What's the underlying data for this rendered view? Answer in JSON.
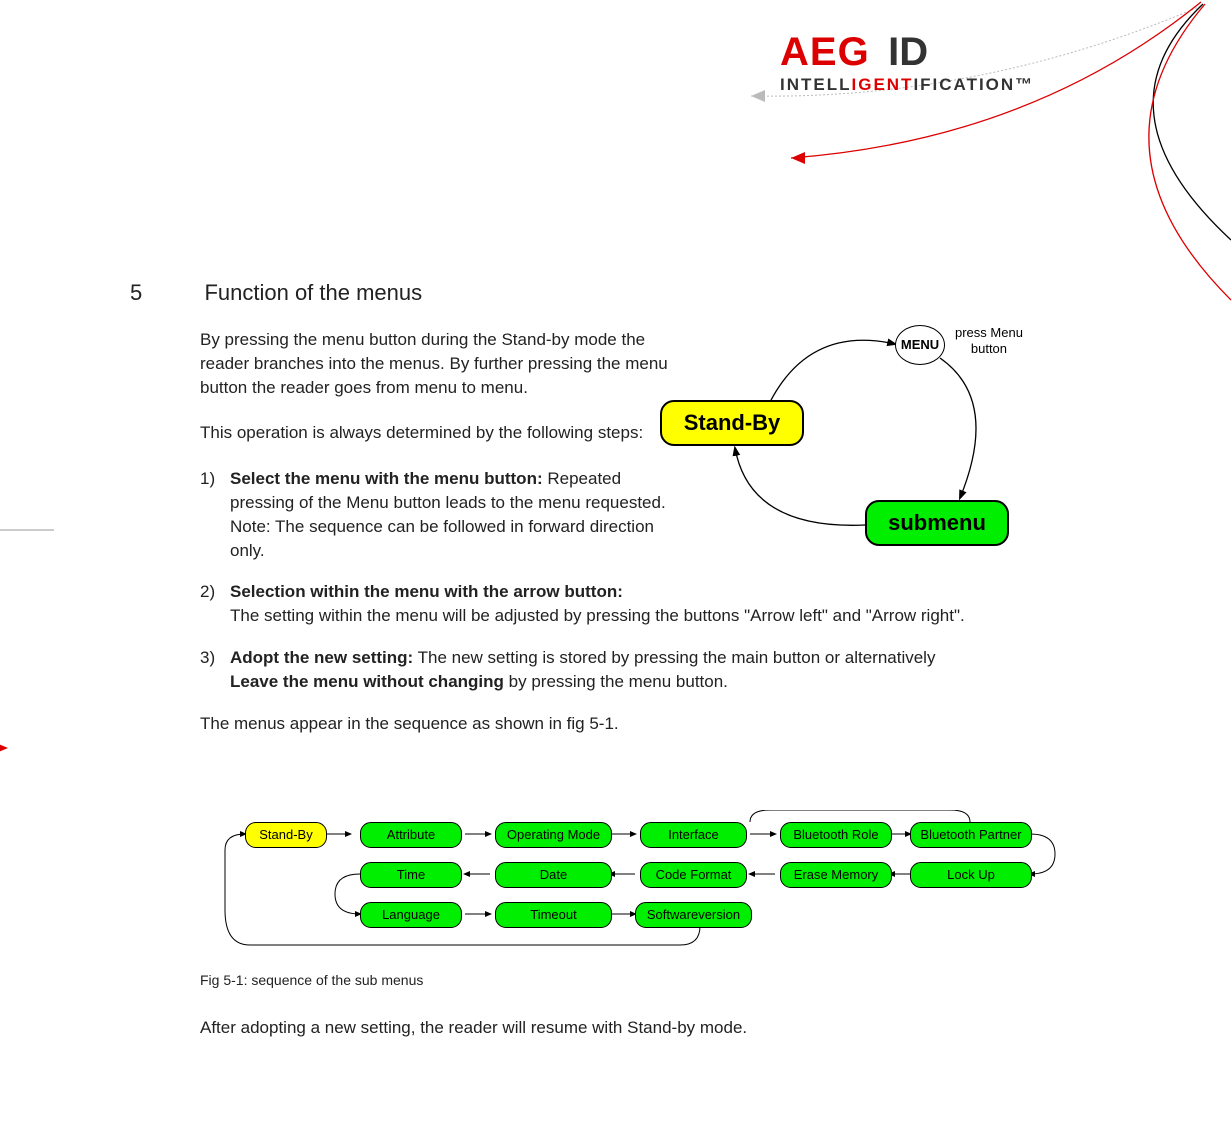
{
  "logo": {
    "brand1": "AEG",
    "brand2": "ID",
    "tagline_prefix": "INTELL",
    "tagline_mid": "IGENT",
    "tagline_suffix": "IFICATION™"
  },
  "section": {
    "number": "5",
    "title": "Function of the menus"
  },
  "intro_para": "By pressing the menu button during the Stand-by mode the reader branches into the menus. By further pressing the menu button the reader goes from menu to menu.",
  "steps_lead": "This operation is always determined by the following steps:",
  "steps": {
    "s1": {
      "num": "1)",
      "bold": "Select the menu with the menu button:",
      "rest": " Repeated pressing of the Menu button leads to the menu requested. Note: The sequence can be followed in forward direction only."
    },
    "s2": {
      "num": "2)",
      "bold": "Selection within the menu with the arrow button:",
      "rest": "The setting within the menu will be adjusted by pressing the buttons \"Arrow left\" and \"Arrow right\"."
    },
    "s3": {
      "num": "3)",
      "bold1": "Adopt the new setting:",
      "mid": " The new setting is stored by pressing the main button or alternatively ",
      "bold2": "Leave the menu without changing",
      "rest": " by pressing the menu button."
    }
  },
  "seq_intro": "The menus appear in the sequence as shown in fig 5-1.",
  "circle": {
    "menu": "MENU",
    "press_line1": "press Menu",
    "press_line2": "button",
    "standby": "Stand-By",
    "submenu": "submenu"
  },
  "seq": {
    "row1": [
      "Stand-By",
      "Attribute",
      "Operating Mode",
      "Interface",
      "Bluetooth Role",
      "Bluetooth Partner"
    ],
    "row2": [
      "Time",
      "Date",
      "Code Format",
      "Erase Memory",
      "Lock Up"
    ],
    "row3": [
      "Language",
      "Timeout",
      "Softwareversion"
    ]
  },
  "fig_caption": "Fig 5-1: sequence of the sub menus",
  "after": "After adopting a new setting, the reader will resume with Stand-by mode."
}
